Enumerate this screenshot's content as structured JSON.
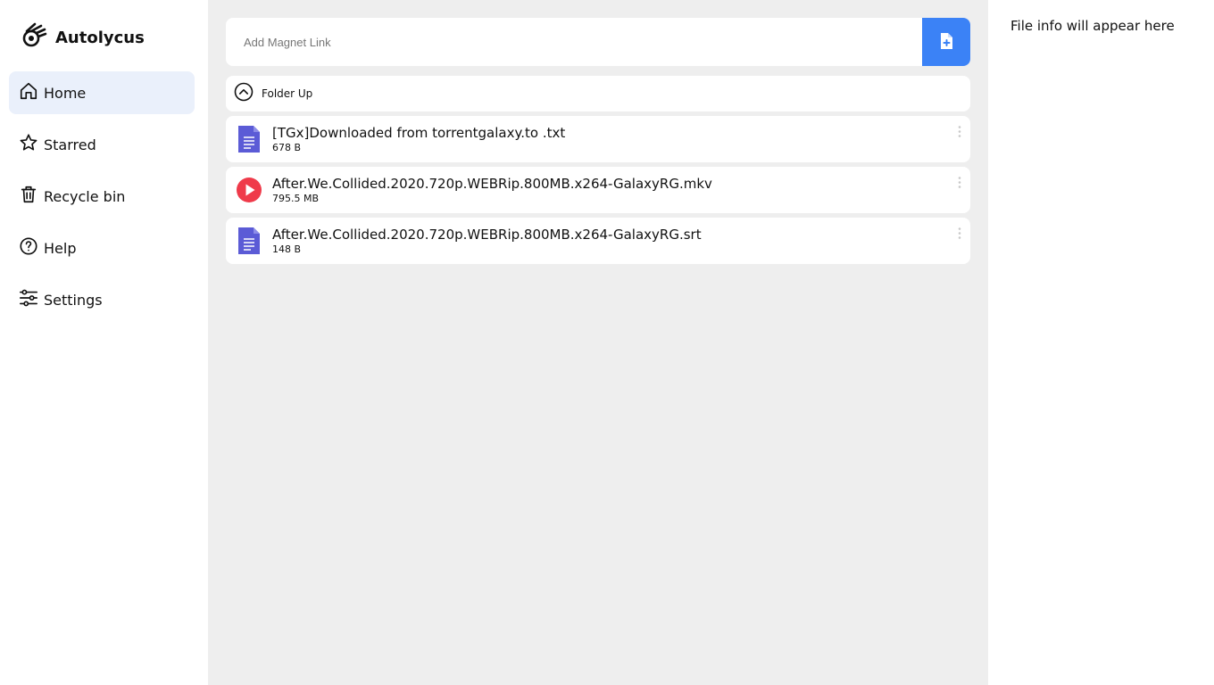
{
  "app": {
    "name": "Autolycus",
    "logo_icon": "meteor-icon"
  },
  "sidebar": {
    "items": [
      {
        "label": "Home",
        "icon": "home-icon",
        "active": true
      },
      {
        "label": "Starred",
        "icon": "star-icon",
        "active": false
      },
      {
        "label": "Recycle bin",
        "icon": "trash-icon",
        "active": false
      },
      {
        "label": "Help",
        "icon": "help-icon",
        "active": false
      },
      {
        "label": "Settings",
        "icon": "sliders-icon",
        "active": false
      }
    ]
  },
  "magnet": {
    "placeholder": "Add Magnet Link",
    "value": "",
    "button_icon": "add-file-icon"
  },
  "folder_up": {
    "label": "Folder Up",
    "icon": "chevron-up-circle-icon"
  },
  "files": [
    {
      "name": "[TGx]Downloaded from torrentgalaxy.to .txt",
      "size": "678 B",
      "icon": "document-icon"
    },
    {
      "name": "After.We.Collided.2020.720p.WEBRip.800MB.x264-GalaxyRG.mkv",
      "size": "795.5 MB",
      "icon": "play-icon"
    },
    {
      "name": "After.We.Collided.2020.720p.WEBRip.800MB.x264-GalaxyRG.srt",
      "size": "148 B",
      "icon": "document-icon"
    }
  ],
  "info_panel": {
    "placeholder": "File info will appear here"
  },
  "colors": {
    "accent": "#3b82f6",
    "doc_icon": "#5b5bd6",
    "play_icon": "#ef3a4a",
    "active_nav_bg": "#eaf0fb",
    "main_bg": "#eeeeee"
  }
}
